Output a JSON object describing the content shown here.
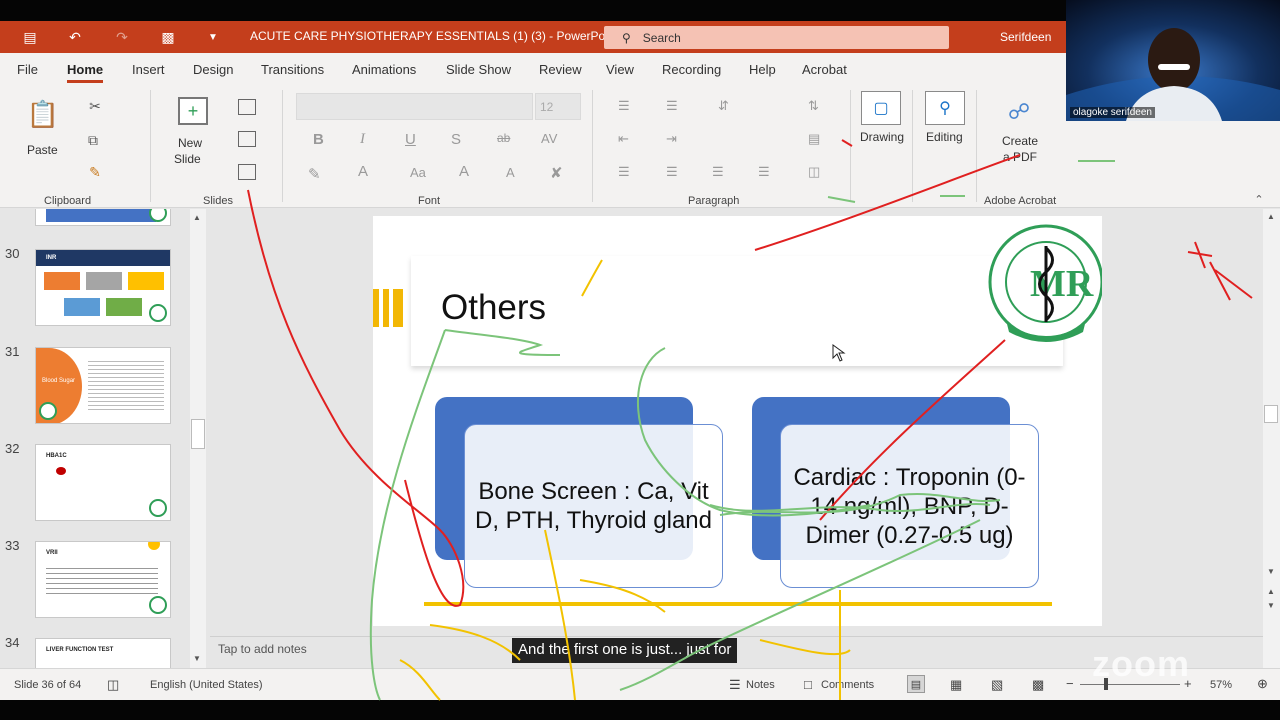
{
  "window": {
    "doc_title": "ACUTE CARE PHYSIOTHERAPY ESSENTIALS (1) (3)  -  PowerPoint",
    "search_placeholder": "Search",
    "user_name": "Serifdeen"
  },
  "menu": [
    "File",
    "Home",
    "Insert",
    "Design",
    "Transitions",
    "Animations",
    "Slide Show",
    "Review",
    "View",
    "Recording",
    "Help",
    "Acrobat"
  ],
  "ribbon": {
    "clipboard": {
      "paste": "Paste",
      "group": "Clipboard"
    },
    "slides": {
      "new_slide_line1": "New",
      "new_slide_line2": "Slide",
      "group": "Slides"
    },
    "font": {
      "size": "12",
      "group": "Font"
    },
    "paragraph": {
      "group": "Paragraph"
    },
    "drawing": "Drawing",
    "editing": "Editing",
    "acrobat": {
      "create_line1": "Create",
      "create_line2": "a PDF",
      "group": "Adobe Acrobat"
    }
  },
  "thumbnails": [
    {
      "number": "30",
      "title": "INR"
    },
    {
      "number": "31",
      "title": "Blood Sugar"
    },
    {
      "number": "32",
      "title": "HBA1C"
    },
    {
      "number": "33",
      "title": "VRII"
    },
    {
      "number": "34",
      "title": "LIVER FUNCTION TEST"
    }
  ],
  "slide": {
    "title": "Others",
    "card_left": "Bone Screen : Ca, Vit D, PTH, Thyroid gland",
    "card_right": "Cardiac : Troponin (0-14 ng/ml), BNP, D-Dimer (0.27-0.5 ug)"
  },
  "notes_placeholder": "Tap to add notes",
  "caption": "And the first one is just... just for",
  "status": {
    "slide_counter": "Slide 36 of 64",
    "language": "English (United States)",
    "notes": "Notes",
    "comments": "Comments",
    "zoom": "57%"
  },
  "video": {
    "participant": "olagoke serifdeen",
    "watermark": "zoom"
  }
}
